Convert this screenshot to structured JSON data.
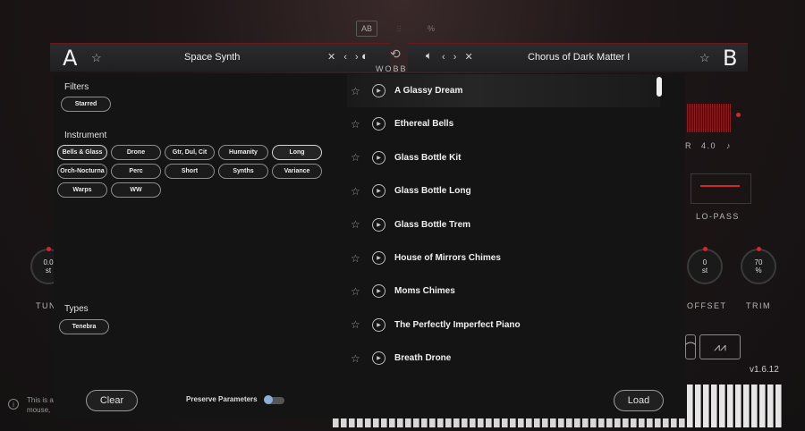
{
  "toolbar": {
    "ab_label": "AB",
    "mixer_icon": "sliders-icon",
    "percent_icon": "percent-icon"
  },
  "slot_a": {
    "letter": "A",
    "preset_name": "Space Synth",
    "icons": "✕ ‹ ›"
  },
  "slot_b": {
    "letter": "B",
    "preset_name": "Chorus of Dark Matter I",
    "icons": "‹ › ✕"
  },
  "wobble_label": "WOBBLE",
  "filters": {
    "title": "Filters",
    "starred_label": "Starred",
    "instrument_title": "Instrument",
    "instrument_chips": [
      "Bells & Glass",
      "Drone",
      "Gtr, Dul, Cit",
      "Humanity",
      "Long",
      "Orch-Nocturna",
      "Perc",
      "Short",
      "Synths",
      "Variance",
      "Warps",
      "WW"
    ],
    "active_chips": [
      "Bells & Glass",
      "Long"
    ],
    "types_title": "Types",
    "types_chips": [
      "Tenebra"
    ]
  },
  "presets": [
    "A Glassy Dream",
    "Ethereal Bells",
    "Glass Bottle Kit",
    "Glass Bottle Long",
    "Glass Bottle Trem",
    "House of Mirrors Chimes",
    "Moms Chimes",
    "The Perfectly Imperfect Piano",
    "Breath Drone"
  ],
  "selected_preset": "A Glassy Dream",
  "buttons": {
    "clear": "Clear",
    "load": "Load"
  },
  "preserve_parameters": {
    "label": "Preserve Parameters",
    "enabled": false
  },
  "background": {
    "tune_value": "0.0",
    "tune_unit": "st",
    "tune_label": "TUN",
    "offset_value": "0",
    "offset_unit": "st",
    "offset_label": "OFFSET",
    "trim_value": "70",
    "trim_unit": "%",
    "trim_label": "TRIM",
    "lopass_label": "LO-PASS",
    "rate_prefix": "R",
    "rate_value": "4.0",
    "note_glyph": "♪",
    "version": "v1.6.12",
    "hint_text": "This is a",
    "hint_text_2": "mouse,"
  },
  "colors": {
    "accent": "#d3262f",
    "panel": "#141414"
  }
}
